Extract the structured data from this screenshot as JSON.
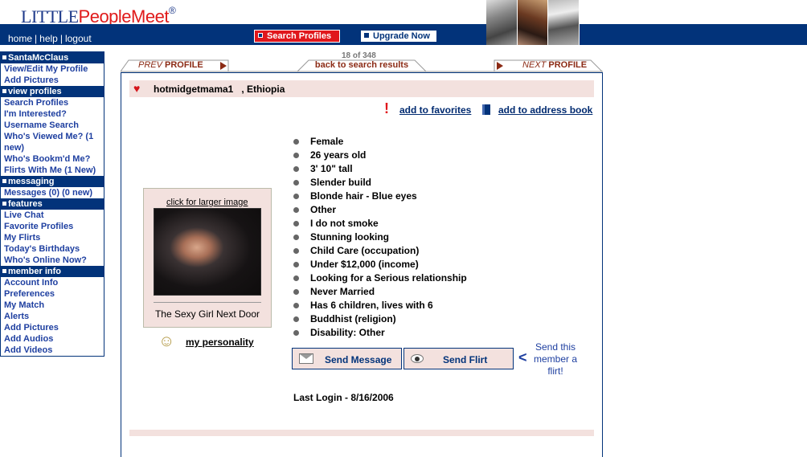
{
  "header": {
    "logo_part1": "LITTLE",
    "logo_part2": "PeopleMeet",
    "logo_mark": "®",
    "links": [
      "home",
      "help",
      "logout"
    ],
    "search_button": "Search Profiles",
    "upgrade_button": "Upgrade Now"
  },
  "sidebar": {
    "sections": [
      {
        "title": "SantaMcClaus",
        "items": [
          "View/Edit My Profile",
          "Add Pictures"
        ]
      },
      {
        "title": "view profiles",
        "items": [
          "Search Profiles",
          "I'm Interested?",
          "Username Search",
          "Who's Viewed Me? (1 new)",
          "Who's Bookm'd Me?",
          "Flirts With Me (1 New)"
        ]
      },
      {
        "title": "messaging",
        "items": [
          "Messages (0) (0 new)"
        ]
      },
      {
        "title": "features",
        "items": [
          "Live Chat",
          "Favorite Profiles",
          "My Flirts",
          "Today's Birthdays",
          "Who's Online Now?"
        ]
      },
      {
        "title": "member info",
        "items": [
          "Account Info",
          "Preferences",
          "My Match",
          "Alerts",
          "Add Pictures",
          "Add Audios",
          "Add Videos"
        ]
      }
    ]
  },
  "nav": {
    "count": "18 of 348",
    "prev_em": "PREV",
    "prev_label": "PROFILE",
    "back_label": "back to search results",
    "next_em": "NEXT",
    "next_label": "PROFILE"
  },
  "profile": {
    "username": "hotmidgetmama1",
    "location": ", Ethiopia",
    "add_favorites": "add to favorites",
    "add_address_book": "add to address book",
    "click_larger": "click for larger image",
    "caption": "The Sexy Girl Next Door",
    "my_personality": "my personality",
    "details": [
      "Female",
      "26 years old",
      "3' 10\" tall",
      "Slender build",
      "Blonde hair - Blue eyes",
      "Other",
      "I do not smoke",
      "Stunning looking",
      "Child Care (occupation)",
      "Under $12,000 (income)",
      "Looking for a Serious relationship",
      "Never Married",
      "Has 6 children, lives with 6",
      "Buddhist (religion)",
      "Disability: Other"
    ],
    "send_message": "Send Message",
    "send_flirt": "Send Flirt",
    "send_this_flirt": "Send this member a flirt!",
    "last_login": "Last Login - 8/16/2006"
  }
}
